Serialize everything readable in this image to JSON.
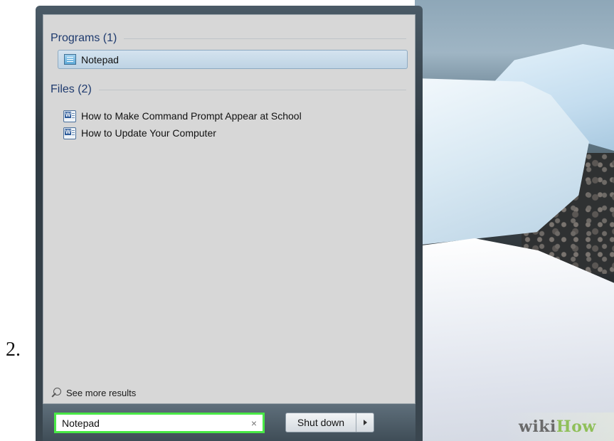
{
  "step_number": "2.",
  "start_menu": {
    "programs_header": "Programs (1)",
    "programs": [
      {
        "label": "Notepad",
        "icon": "notepad-icon"
      }
    ],
    "files_header": "Files (2)",
    "files": [
      {
        "label": "How to Make Command Prompt Appear at School",
        "icon": "word-document-icon"
      },
      {
        "label": "How to Update Your Computer",
        "icon": "word-document-icon"
      }
    ],
    "see_more": "See more results",
    "search": {
      "value": "Notepad",
      "clear_symbol": "×"
    },
    "shutdown_label": "Shut down"
  },
  "watermark": {
    "part1": "wiki",
    "part2": "How"
  },
  "colors": {
    "search_highlight": "#49e846",
    "selected_item": "#c8dbea",
    "header_text": "#1e3a6e"
  }
}
